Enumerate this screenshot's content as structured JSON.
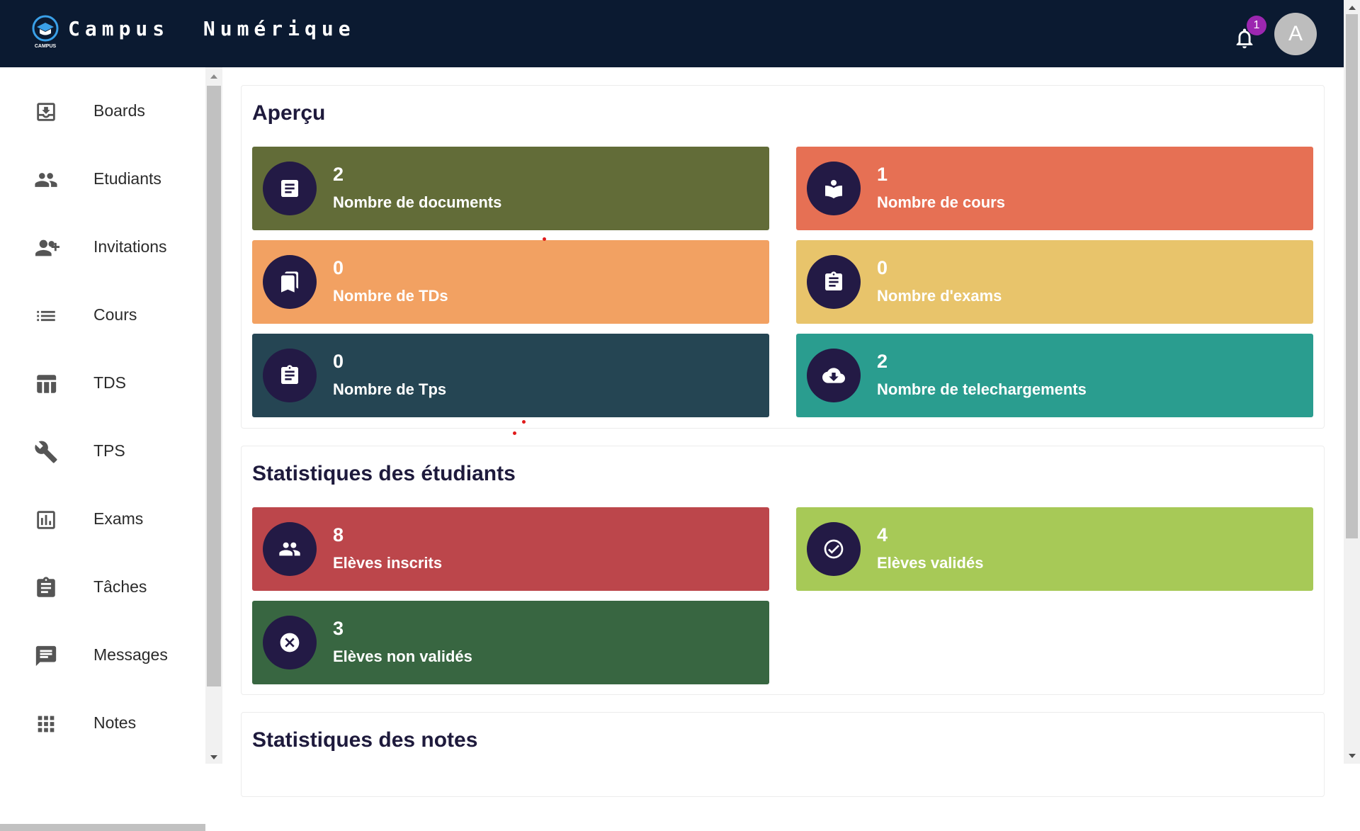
{
  "header": {
    "brand": "Campus  Numérique",
    "logo_text": "CAMPUS",
    "notification_count": "1",
    "avatar_letter": "A"
  },
  "sidebar": {
    "items": [
      {
        "label": "Boards",
        "icon": "download-box-icon"
      },
      {
        "label": "Etudiants",
        "icon": "people-icon"
      },
      {
        "label": "Invitations",
        "icon": "person-add-icon"
      },
      {
        "label": "Cours",
        "icon": "list-icon"
      },
      {
        "label": "TDS",
        "icon": "table-icon"
      },
      {
        "label": "TPS",
        "icon": "wrench-icon"
      },
      {
        "label": "Exams",
        "icon": "bar-chart-icon"
      },
      {
        "label": "Tâches",
        "icon": "clipboard-icon"
      },
      {
        "label": "Messages",
        "icon": "message-icon"
      },
      {
        "label": "Notes",
        "icon": "grid-icon"
      }
    ]
  },
  "overview": {
    "title": "Aperçu",
    "cards": [
      {
        "value": "2",
        "label": "Nombre de documents",
        "color": "#626c38",
        "icon": "document-icon"
      },
      {
        "value": "1",
        "label": "Nombre de cours",
        "color": "#e67054",
        "icon": "book-reader-icon"
      },
      {
        "value": "0",
        "label": "Nombre de TDs",
        "color": "#f2a162",
        "icon": "bookmarks-icon"
      },
      {
        "value": "0",
        "label": "Nombre d'exams",
        "color": "#e8c46b",
        "icon": "clipboard-icon"
      },
      {
        "value": "0",
        "label": "Nombre de Tps",
        "color": "#254553",
        "icon": "clipboard-icon"
      },
      {
        "value": "2",
        "label": "Nombre de telechargements",
        "color": "#2a9d8f",
        "icon": "cloud-download-icon"
      }
    ]
  },
  "students": {
    "title": "Statistiques des étudiants",
    "cards": [
      {
        "value": "8",
        "label": "Elèves inscrits",
        "color": "#bc464b",
        "icon": "people-icon"
      },
      {
        "value": "4",
        "label": "Elèves validés",
        "color": "#a7c957",
        "icon": "check-circle-icon"
      },
      {
        "value": "3",
        "label": "Elèves non validés",
        "color": "#386641",
        "icon": "cancel-circle-icon"
      }
    ]
  },
  "notes": {
    "title": "Statistiques des notes"
  }
}
